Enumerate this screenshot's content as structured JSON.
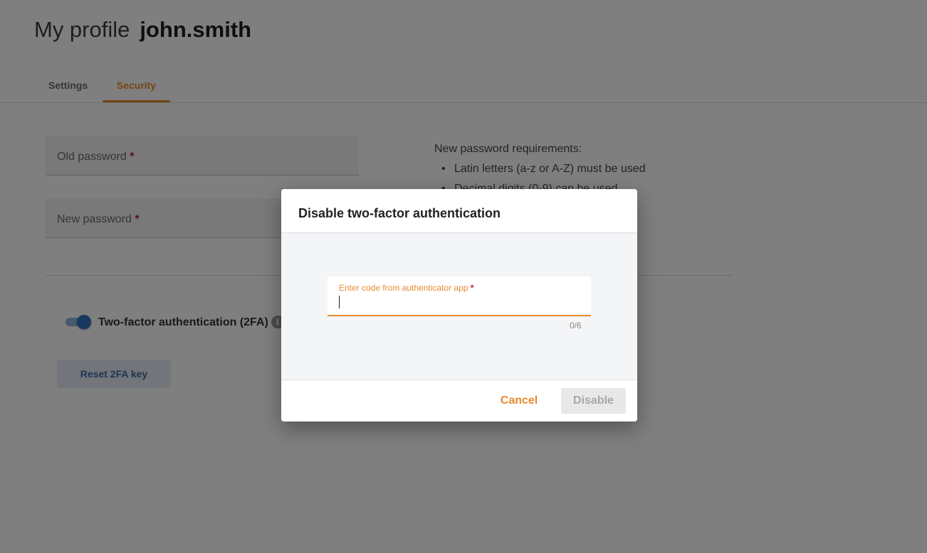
{
  "header": {
    "title": "My profile",
    "username": "john.smith"
  },
  "tabs": [
    {
      "label": "Settings",
      "active": false
    },
    {
      "label": "Security",
      "active": true
    }
  ],
  "form": {
    "old_password_label": "Old password",
    "new_password_label": "New password",
    "required_mark": "*"
  },
  "requirements": {
    "title": "New password requirements:",
    "items": [
      "Latin letters (a-z or A-Z) must be used",
      "Decimal digits (0-9) can be used"
    ]
  },
  "two_factor": {
    "label": "Two-factor authentication (2FA)",
    "enabled": true,
    "info_icon": "i",
    "reset_button": "Reset 2FA key"
  },
  "dialog": {
    "title": "Disable two-factor authentication",
    "field_label": "Enter code from authenticator app",
    "required_mark": "*",
    "value": "",
    "counter": "0/6",
    "cancel_label": "Cancel",
    "disable_label": "Disable"
  },
  "colors": {
    "accent": "#e8892e",
    "toggle": "#2f72c0",
    "required": "#c1121f"
  }
}
